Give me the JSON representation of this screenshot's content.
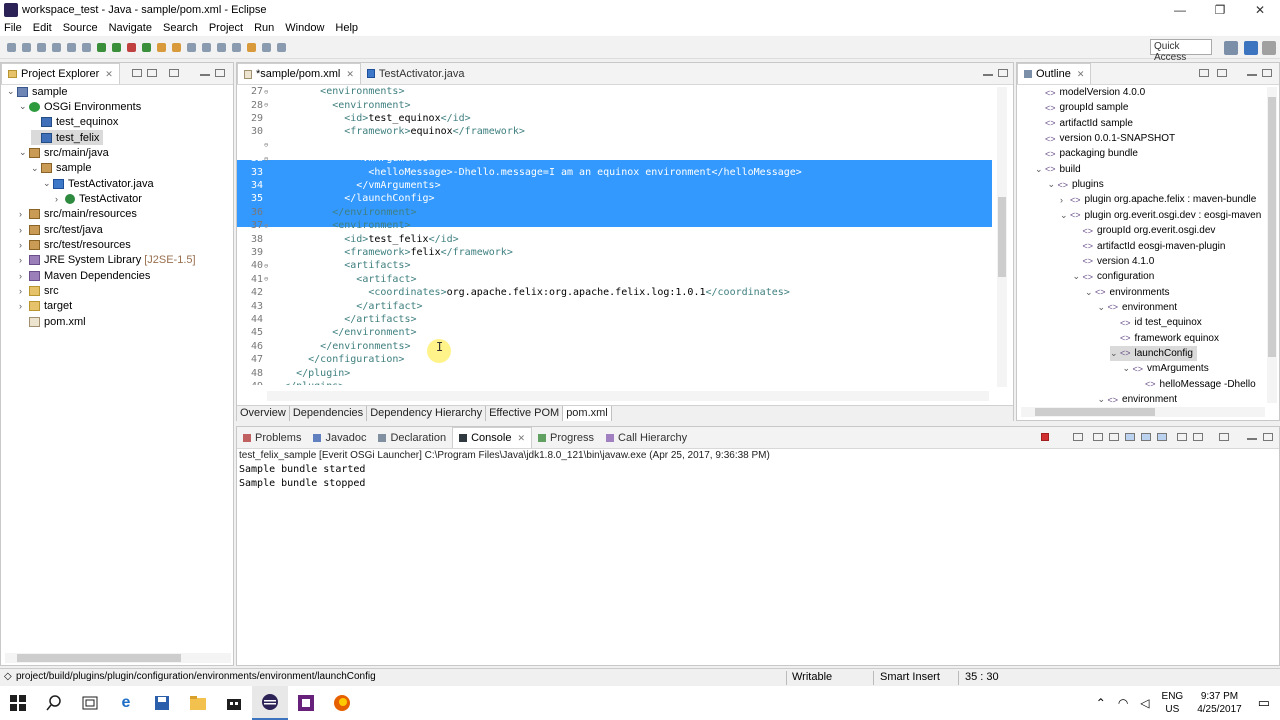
{
  "window": {
    "title": "workspace_test - Java - sample/pom.xml - Eclipse",
    "minimize": "—",
    "restore": "❐",
    "close": "✕"
  },
  "menu": [
    "File",
    "Edit",
    "Source",
    "Navigate",
    "Search",
    "Project",
    "Run",
    "Window",
    "Help"
  ],
  "toolbar": {
    "quick_access": "Quick Access"
  },
  "explorer": {
    "tab": "Project Explorer",
    "items": [
      {
        "label": "sample",
        "icon": "project-icon",
        "twisty": "⌄",
        "indent": 0
      },
      {
        "label": "OSGi Environments",
        "icon": "osgi-icon",
        "twisty": "⌄",
        "indent": 1
      },
      {
        "label": "test_equinox",
        "icon": "config-icon",
        "twisty": "",
        "indent": 2
      },
      {
        "label": "test_felix",
        "icon": "config-icon",
        "twisty": "",
        "indent": 2,
        "selected": true
      },
      {
        "label": "src/main/java",
        "icon": "source-folder-icon",
        "twisty": "⌄",
        "indent": 1
      },
      {
        "label": "sample",
        "icon": "package-icon",
        "twisty": "⌄",
        "indent": 2
      },
      {
        "label": "TestActivator.java",
        "icon": "java-file-icon",
        "twisty": "⌄",
        "indent": 3
      },
      {
        "label": "TestActivator",
        "icon": "class-icon",
        "twisty": "›",
        "indent": 4
      },
      {
        "label": "src/main/resources",
        "icon": "source-folder-icon",
        "twisty": "›",
        "indent": 1
      },
      {
        "label": "src/test/java",
        "icon": "source-folder-icon",
        "twisty": "›",
        "indent": 1
      },
      {
        "label": "src/test/resources",
        "icon": "source-folder-icon",
        "twisty": "›",
        "indent": 1
      },
      {
        "label": "JRE System Library",
        "icon": "library-icon",
        "twisty": "›",
        "indent": 1,
        "suffix": "[J2SE-1.5]"
      },
      {
        "label": "Maven Dependencies",
        "icon": "library-icon",
        "twisty": "›",
        "indent": 1
      },
      {
        "label": "src",
        "icon": "folder-icon",
        "twisty": "›",
        "indent": 1
      },
      {
        "label": "target",
        "icon": "folder-icon",
        "twisty": "›",
        "indent": 1
      },
      {
        "label": "pom.xml",
        "icon": "xml-file-icon",
        "twisty": "",
        "indent": 1
      }
    ]
  },
  "editor": {
    "tabs": [
      {
        "label": "*sample/pom.xml",
        "active": true
      },
      {
        "label": "TestActivator.java",
        "active": false
      }
    ],
    "lines": [
      {
        "n": "27",
        "fold": "⊖",
        "pre": "        ",
        "parts": [
          [
            "tag",
            "<environments>"
          ]
        ]
      },
      {
        "n": "28",
        "fold": "⊖",
        "pre": "          ",
        "parts": [
          [
            "tag",
            "<environment>"
          ]
        ]
      },
      {
        "n": "29",
        "fold": "",
        "pre": "            ",
        "parts": [
          [
            "tag",
            "<id>"
          ],
          [
            "txt",
            "test_equinox"
          ],
          [
            "tag",
            "</id>"
          ]
        ]
      },
      {
        "n": "30",
        "fold": "",
        "pre": "            ",
        "parts": [
          [
            "tag",
            "<framework>"
          ],
          [
            "txt",
            "equinox"
          ],
          [
            "tag",
            "</framework>"
          ]
        ]
      },
      {
        "n": "31",
        "fold": "⊖",
        "pre": "            ",
        "parts": [
          [
            "tag",
            "<launchConfig>"
          ]
        ],
        "sel": true
      },
      {
        "n": "32",
        "fold": "⊖",
        "pre": "              ",
        "parts": [
          [
            "tag",
            "<vmArguments>"
          ]
        ],
        "sel": true
      },
      {
        "n": "33",
        "fold": "",
        "pre": "                ",
        "parts": [
          [
            "tag",
            "<helloMessage>"
          ],
          [
            "txt",
            "-Dhello.message=I am an equinox environment"
          ],
          [
            "tag",
            "</helloMessage>"
          ]
        ],
        "sel": true
      },
      {
        "n": "34",
        "fold": "",
        "pre": "              ",
        "parts": [
          [
            "tag",
            "</vmArguments>"
          ]
        ],
        "sel": true
      },
      {
        "n": "35",
        "fold": "",
        "pre": "            ",
        "parts": [
          [
            "tag",
            "</launchConfig>"
          ]
        ],
        "sel": true
      },
      {
        "n": "36",
        "fold": "",
        "pre": "          ",
        "parts": [
          [
            "tag",
            "</environment>"
          ]
        ]
      },
      {
        "n": "37",
        "fold": "⊖",
        "pre": "          ",
        "parts": [
          [
            "tag",
            "<environment>"
          ]
        ]
      },
      {
        "n": "38",
        "fold": "",
        "pre": "            ",
        "parts": [
          [
            "tag",
            "<id>"
          ],
          [
            "txt",
            "test_felix"
          ],
          [
            "tag",
            "</id>"
          ]
        ]
      },
      {
        "n": "39",
        "fold": "",
        "pre": "            ",
        "parts": [
          [
            "tag",
            "<framework>"
          ],
          [
            "txt",
            "felix"
          ],
          [
            "tag",
            "</framework>"
          ]
        ]
      },
      {
        "n": "40",
        "fold": "⊖",
        "pre": "            ",
        "parts": [
          [
            "tag",
            "<artifacts>"
          ]
        ]
      },
      {
        "n": "41",
        "fold": "⊖",
        "pre": "              ",
        "parts": [
          [
            "tag",
            "<artifact>"
          ]
        ]
      },
      {
        "n": "42",
        "fold": "",
        "pre": "                ",
        "parts": [
          [
            "tag",
            "<coordinates>"
          ],
          [
            "txt",
            "org.apache.felix:org.apache.felix.log:1.0.1"
          ],
          [
            "tag",
            "</coordinates>"
          ]
        ]
      },
      {
        "n": "43",
        "fold": "",
        "pre": "              ",
        "parts": [
          [
            "tag",
            "</artifact>"
          ]
        ]
      },
      {
        "n": "44",
        "fold": "",
        "pre": "            ",
        "parts": [
          [
            "tag",
            "</artifacts>"
          ]
        ]
      },
      {
        "n": "45",
        "fold": "",
        "pre": "          ",
        "parts": [
          [
            "tag",
            "</environment>"
          ]
        ]
      },
      {
        "n": "46",
        "fold": "",
        "pre": "        ",
        "parts": [
          [
            "tag",
            "</environments>"
          ]
        ]
      },
      {
        "n": "47",
        "fold": "",
        "pre": "      ",
        "parts": [
          [
            "tag",
            "</configuration>"
          ]
        ]
      },
      {
        "n": "48",
        "fold": "",
        "pre": "    ",
        "parts": [
          [
            "tag",
            "</plugin>"
          ]
        ]
      },
      {
        "n": "49",
        "fold": "",
        "pre": "  ",
        "parts": [
          [
            "tag",
            "</plugins>"
          ]
        ]
      }
    ],
    "bottom_tabs": [
      {
        "label": "Overview",
        "active": false
      },
      {
        "label": "Dependencies",
        "active": false
      },
      {
        "label": "Dependency Hierarchy",
        "active": false
      },
      {
        "label": "Effective POM",
        "active": false
      },
      {
        "label": "pom.xml",
        "active": true
      }
    ]
  },
  "outline": {
    "tab": "Outline",
    "items": [
      {
        "label": "modelVersion  4.0.0",
        "twisty": "",
        "indent": 1
      },
      {
        "label": "groupId  sample",
        "twisty": "",
        "indent": 1
      },
      {
        "label": "artifactId  sample",
        "twisty": "",
        "indent": 1
      },
      {
        "label": "version  0.0.1-SNAPSHOT",
        "twisty": "",
        "indent": 1
      },
      {
        "label": "packaging  bundle",
        "twisty": "",
        "indent": 1
      },
      {
        "label": "build",
        "twisty": "⌄",
        "indent": 1
      },
      {
        "label": "plugins",
        "twisty": "⌄",
        "indent": 2
      },
      {
        "label": "plugin  org.apache.felix : maven-bundle",
        "twisty": "›",
        "indent": 3
      },
      {
        "label": "plugin  org.everit.osgi.dev : eosgi-maven",
        "twisty": "⌄",
        "indent": 3
      },
      {
        "label": "groupId  org.everit.osgi.dev",
        "twisty": "",
        "indent": 4
      },
      {
        "label": "artifactId  eosgi-maven-plugin",
        "twisty": "",
        "indent": 4
      },
      {
        "label": "version  4.1.0",
        "twisty": "",
        "indent": 4
      },
      {
        "label": "configuration",
        "twisty": "⌄",
        "indent": 4
      },
      {
        "label": "environments",
        "twisty": "⌄",
        "indent": 5
      },
      {
        "label": "environment",
        "twisty": "⌄",
        "indent": 6
      },
      {
        "label": "id  test_equinox",
        "twisty": "",
        "indent": 7
      },
      {
        "label": "framework  equinox",
        "twisty": "",
        "indent": 7
      },
      {
        "label": "launchConfig",
        "twisty": "⌄",
        "indent": 7,
        "selected": true
      },
      {
        "label": "vmArguments",
        "twisty": "⌄",
        "indent": 8
      },
      {
        "label": "helloMessage  -Dhello",
        "twisty": "",
        "indent": 9
      },
      {
        "label": "environment",
        "twisty": "⌄",
        "indent": 6
      }
    ]
  },
  "console": {
    "tabs": [
      {
        "label": "Problems",
        "active": false
      },
      {
        "label": "Javadoc",
        "active": false
      },
      {
        "label": "Declaration",
        "active": false
      },
      {
        "label": "Console",
        "active": true
      },
      {
        "label": "Progress",
        "active": false
      },
      {
        "label": "Call Hierarchy",
        "active": false
      }
    ],
    "header": "test_felix_sample [Everit OSGi Launcher] C:\\Program Files\\Java\\jdk1.8.0_121\\bin\\javaw.exe (Apr 25, 2017, 9:36:38 PM)",
    "lines": [
      "Sample bundle started",
      "Sample bundle stopped"
    ]
  },
  "status": {
    "path": "project/build/plugins/plugin/configuration/environments/environment/launchConfig",
    "writable": "Writable",
    "insert_mode": "Smart Insert",
    "position": "35 : 30"
  },
  "taskbar": {
    "lang": "ENG",
    "region": "US",
    "time": "9:37 PM",
    "date": "4/25/2017"
  }
}
